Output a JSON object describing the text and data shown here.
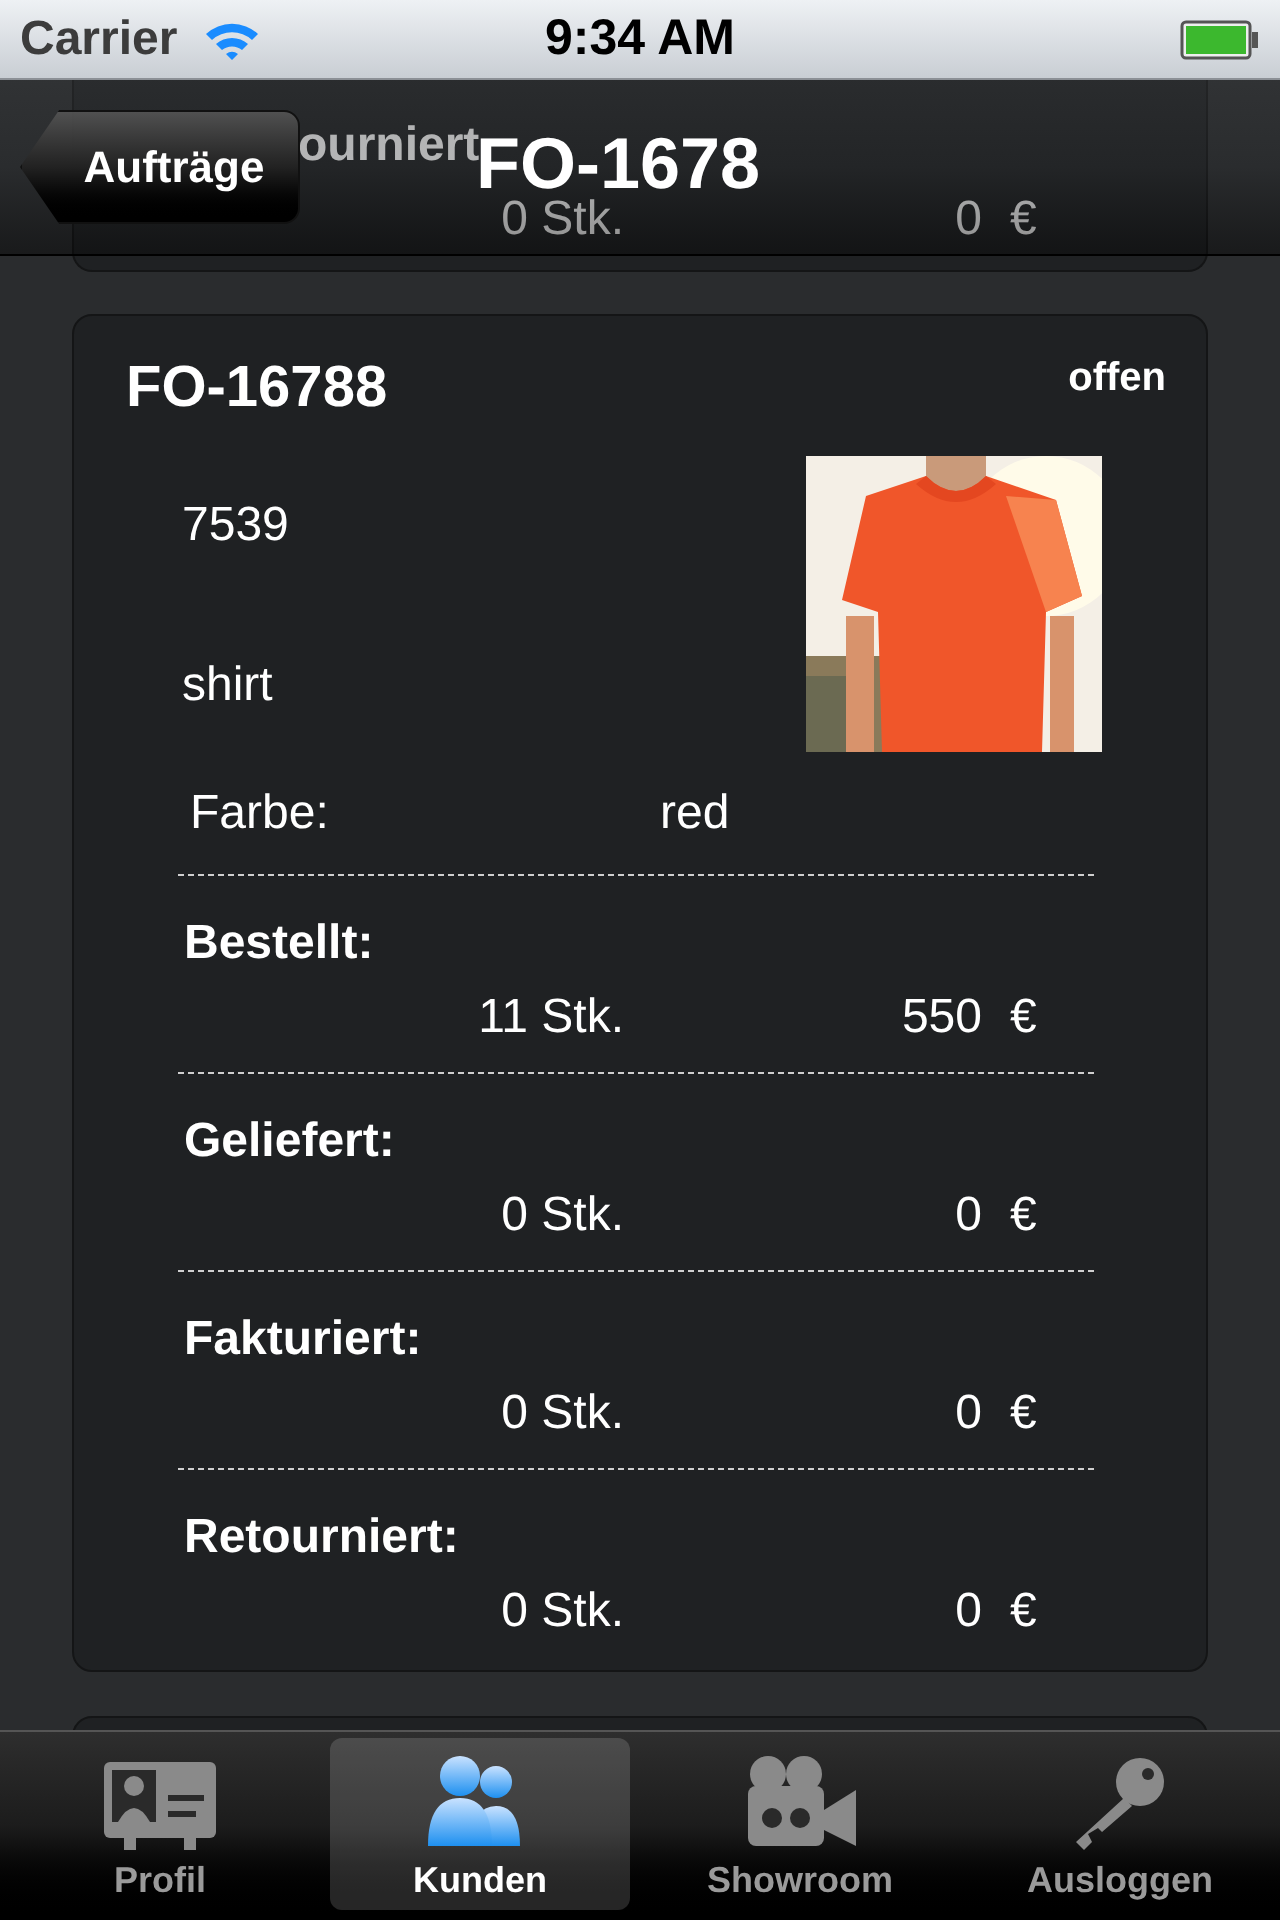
{
  "status_bar": {
    "carrier": "Carrier",
    "time": "9:34 AM"
  },
  "nav_bar": {
    "back_button": "Aufträge",
    "title": "FO-1678"
  },
  "previous_order": {
    "label": "ourniert",
    "quantity": "0 Stk.",
    "amount": "0",
    "currency": "€"
  },
  "order": {
    "number": "FO-16788",
    "status": "offen",
    "article_number": "7539",
    "article_name": "shirt",
    "color_label": "Farbe:",
    "color_value": "red",
    "sections": [
      {
        "label": "Bestellt:",
        "quantity": "11 Stk.",
        "amount": "550",
        "currency": "€"
      },
      {
        "label": "Geliefert:",
        "quantity": "0 Stk.",
        "amount": "0",
        "currency": "€"
      },
      {
        "label": "Fakturiert:",
        "quantity": "0 Stk.",
        "amount": "0",
        "currency": "€"
      },
      {
        "label": "Retourniert:",
        "quantity": "0 Stk.",
        "amount": "0",
        "currency": "€"
      }
    ]
  },
  "tab_bar": [
    {
      "label": "Profil",
      "kind": "contact-card",
      "selected": false
    },
    {
      "label": "Kunden",
      "kind": "people",
      "selected": true
    },
    {
      "label": "Showroom",
      "kind": "camera",
      "selected": false
    },
    {
      "label": "Ausloggen",
      "kind": "key",
      "selected": false
    }
  ]
}
